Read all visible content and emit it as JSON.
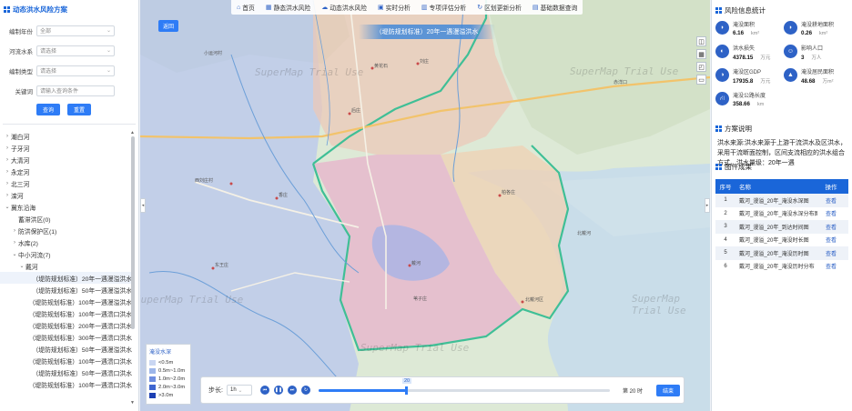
{
  "left": {
    "title": "动态洪水风险方案",
    "filters": [
      {
        "label": "编制年份",
        "value": "全部"
      },
      {
        "label": "河流水系",
        "value": "请选择"
      },
      {
        "label": "编制类型",
        "value": "请选择"
      },
      {
        "label": "关键词",
        "value": "请输入查询条件"
      }
    ],
    "query_label": "查询",
    "reset_label": "重置",
    "tree": [
      {
        "label": "潮白河",
        "indent": 0,
        "arrow": "›"
      },
      {
        "label": "子牙河",
        "indent": 0,
        "arrow": "›"
      },
      {
        "label": "大清河",
        "indent": 0,
        "arrow": "›"
      },
      {
        "label": "永定河",
        "indent": 0,
        "arrow": "›"
      },
      {
        "label": "北三河",
        "indent": 0,
        "arrow": "›"
      },
      {
        "label": "滦河",
        "indent": 0,
        "arrow": "›"
      },
      {
        "label": "冀东沿海",
        "indent": 0,
        "arrow": "⌄"
      },
      {
        "label": "蓄滞洪区(0)",
        "indent": 1,
        "arrow": ""
      },
      {
        "label": "防洪保护区(1)",
        "indent": 1,
        "arrow": "›"
      },
      {
        "label": "水库(2)",
        "indent": 1,
        "arrow": "›"
      },
      {
        "label": "中小河流(7)",
        "indent": 1,
        "arrow": "⌄"
      },
      {
        "label": "戴河",
        "indent": 2,
        "arrow": "⌄"
      },
      {
        "label": "（堤防规划标准）20年一遇漫溢洪水",
        "indent": 3,
        "arrow": ""
      },
      {
        "label": "（堤防规划标准）50年一遇漫溢洪水",
        "indent": 3,
        "arrow": ""
      },
      {
        "label": "（堤防规划标准）100年一遇漫溢洪水",
        "indent": 3,
        "arrow": ""
      },
      {
        "label": "（堤防规划标准）100年一遇溃口洪水",
        "indent": 3,
        "arrow": ""
      },
      {
        "label": "（堤防规划标准）200年一遇溃口洪水",
        "indent": 3,
        "arrow": ""
      },
      {
        "label": "（堤防规划标准）300年一遇溃口洪水",
        "indent": 3,
        "arrow": ""
      },
      {
        "label": "（堤防规划标准）50年一遇漫溢洪水",
        "indent": 3,
        "arrow": ""
      },
      {
        "label": "（堤防规划标准）100年一遇溃口洪水",
        "indent": 3,
        "arrow": ""
      },
      {
        "label": "（堤防规划标准）50年一遇溃口洪水",
        "indent": 3,
        "arrow": ""
      },
      {
        "label": "（堤防规划标准）100年一遇溃口洪水",
        "indent": 3,
        "arrow": ""
      }
    ]
  },
  "nav": [
    {
      "icon": "⌂",
      "label": "首页"
    },
    {
      "icon": "▦",
      "label": "静态洪水风险"
    },
    {
      "icon": "☁",
      "label": "动态洪水风险"
    },
    {
      "icon": "▣",
      "label": "实时分析"
    },
    {
      "icon": "▥",
      "label": "专项评估分析"
    },
    {
      "icon": "↻",
      "label": "区划更新分析"
    },
    {
      "icon": "▤",
      "label": "基础数据查询"
    }
  ],
  "map": {
    "back_label": "返回",
    "banner": "（堤防规划标准）20年一遇漫溢洪水",
    "watermark": "SuperMap Trial Use",
    "legend_title": "淹没水深",
    "legend": [
      {
        "label": "<0.5m",
        "color": "#c9d6f2"
      },
      {
        "label": "0.5m~1.0m",
        "color": "#9db6ea"
      },
      {
        "label": "1.0m~2.0m",
        "color": "#6f8ee0"
      },
      {
        "label": "2.0m~3.0m",
        "color": "#3f66d0"
      },
      {
        "label": ">3.0m",
        "color": "#1c3fb3"
      }
    ],
    "step_label": "步长:",
    "step_value": "1h",
    "progress_value": "20",
    "progress_fraction": 0.3,
    "time_label": "第 20 时",
    "end_label": "结束",
    "places": [
      "小运河村",
      "北戴河",
      "赤洋口",
      "黄花石",
      "刘庄",
      "后庄",
      "柏各庄",
      "香庄",
      "西刘庄村",
      "东王庄",
      "苇子庄",
      "北戴河区",
      "戴河"
    ]
  },
  "right": {
    "risk_title": "风险信息统计",
    "stats": [
      {
        "icon": "◗",
        "label": "淹没面积",
        "value": "6.16",
        "unit": "km²"
      },
      {
        "icon": "◗",
        "label": "淹没耕地面积",
        "value": "0.26",
        "unit": "km²"
      },
      {
        "icon": "◐",
        "label": "洪水损失",
        "value": "4378.15",
        "unit": "万元"
      },
      {
        "icon": "☺",
        "label": "影响人口",
        "value": "3",
        "unit": "万人"
      },
      {
        "icon": "◑",
        "label": "淹没区GDP",
        "value": "17935.8",
        "unit": "万元"
      },
      {
        "icon": "▲",
        "label": "淹没居民面积",
        "value": "48.68",
        "unit": "万m²"
      },
      {
        "icon": "⛙",
        "label": "淹没公路长度",
        "value": "358.66",
        "unit": "km"
      }
    ],
    "plan_title": "方案说明",
    "plan_text": "洪水来源:洪水来源于上游干流洪水及区洪水，采用干流断面控制，区间支流相应的洪水组合方式，洪水量级：20年一遇",
    "results_title": "图件成果",
    "table_headers": [
      "序号",
      "名称",
      "操作"
    ],
    "rows": [
      {
        "no": "1",
        "name": "戴河_漫溢_20年_淹没水深图",
        "op": "查看"
      },
      {
        "no": "2",
        "name": "戴河_漫溢_20年_淹没水深分布图",
        "op": "查看"
      },
      {
        "no": "3",
        "name": "戴河_漫溢_20年_到达时间图",
        "op": "查看"
      },
      {
        "no": "4",
        "name": "戴河_漫溢_20年_淹没时长图",
        "op": "查看"
      },
      {
        "no": "5",
        "name": "戴河_漫溢_20年_淹没历时图",
        "op": "查看"
      },
      {
        "no": "6",
        "name": "戴河_漫溢_20年_淹没历时分布",
        "op": "查看"
      }
    ]
  }
}
